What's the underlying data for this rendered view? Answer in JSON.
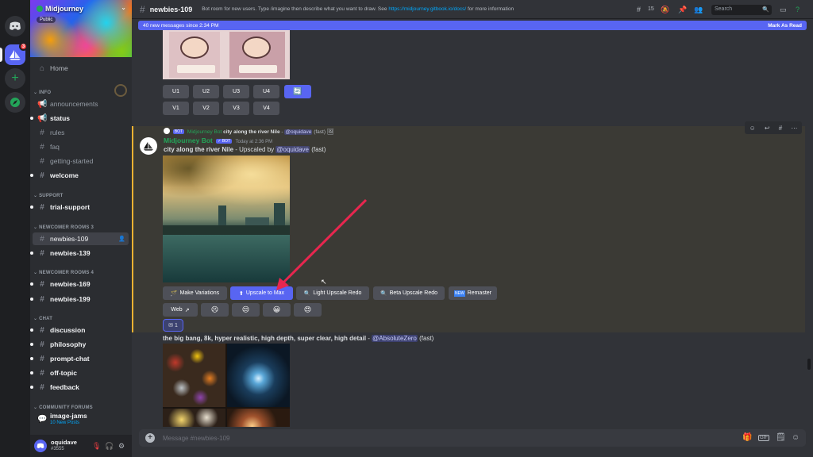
{
  "server": {
    "name": "Midjourney",
    "tag": "Public"
  },
  "guild_rail": {
    "badge_count": "3"
  },
  "sidebar": {
    "home": "Home",
    "categories": {
      "info": "INFO",
      "support": "SUPPORT",
      "newcomer3": "NEWCOMER ROOMS 3",
      "newcomer4": "NEWCOMER ROOMS 4",
      "chat": "CHAT",
      "forums": "COMMUNITY FORUMS"
    },
    "channels": [
      "announcements",
      "status",
      "rules",
      "faq",
      "getting-started",
      "welcome",
      "trial-support",
      "newbies-109",
      "newbies-139",
      "newbies-169",
      "newbies-199",
      "discussion",
      "philosophy",
      "prompt-chat",
      "off-topic",
      "feedback",
      "image-jams"
    ],
    "new_posts": "10 New Posts"
  },
  "user": {
    "name": "oquidave",
    "tag": "#3555"
  },
  "topbar": {
    "channel": "newbies-109",
    "topic_prefix": "Bot room for new users. Type /imagine then describe what you want to draw. See",
    "topic_link": "https://midjourney.gitbook.io/docs/",
    "topic_suffix": "for more information",
    "member_count": "15",
    "search_placeholder": "Search"
  },
  "new_messages": {
    "text": "40 new messages since 2:34 PM",
    "mark_read": "Mark As Read"
  },
  "grid_buttons": {
    "u": [
      "U1",
      "U2",
      "U3",
      "U4"
    ],
    "v": [
      "V1",
      "V2",
      "V3",
      "V4"
    ]
  },
  "upscale_message": {
    "reply_author": "Midjourney Bot",
    "reply_badge": "BOT",
    "reply_prompt": "city along the river Nile",
    "reply_mention": "@oquidave",
    "reply_speed": "(fast)",
    "author": "Midjourney Bot",
    "badge": "BOT",
    "timestamp": "Today at 2:36 PM",
    "prompt": "city along the river Nile",
    "upscaled_by": " - Upscaled by ",
    "mention": "@oquidave",
    "speed": "(fast)",
    "buttons": [
      "Make Variations",
      "Upscale to Max",
      "Light Upscale Redo",
      "Beta Upscale Redo",
      "Remaster"
    ],
    "web_button": "Web",
    "reactions": [
      "😣",
      "😒",
      "😀",
      "😍"
    ],
    "reaction_count": "1"
  },
  "next_message": {
    "prompt": "the big bang, 8k, hyper realistic, high depth, super clear, high detail",
    "mention": "@AbsoluteZero",
    "speed": "(fast)"
  },
  "composer": {
    "placeholder": "Message #newbies-109"
  },
  "colors": {
    "accent": "#5865f2",
    "highlight_border": "#f0b232",
    "annotation_arrow": "#e8264f"
  }
}
